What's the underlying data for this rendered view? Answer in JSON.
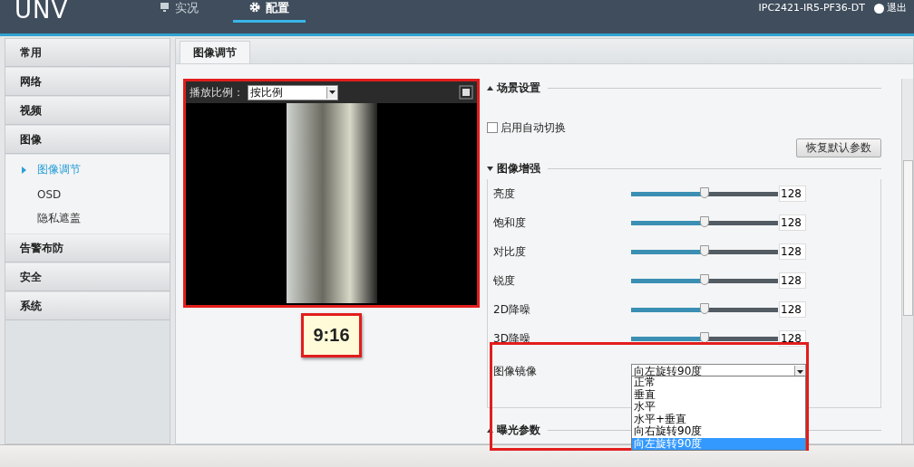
{
  "header": {
    "logo": "UNV",
    "nav": [
      {
        "label": "实况",
        "selected": false
      },
      {
        "label": "配置",
        "selected": true
      }
    ],
    "device": "IPC2421-IR5-PF36-DT",
    "logout": "退出"
  },
  "sidebar": {
    "items": [
      {
        "label": "常用"
      },
      {
        "label": "网络"
      },
      {
        "label": "视频"
      },
      {
        "label": "图像",
        "children": [
          {
            "label": "图像调节",
            "selected": true
          },
          {
            "label": "OSD",
            "selected": false
          },
          {
            "label": "隐私遮盖",
            "selected": false
          }
        ]
      },
      {
        "label": "告警布防"
      },
      {
        "label": "安全"
      },
      {
        "label": "系统"
      }
    ]
  },
  "tabs": [
    {
      "label": "图像调节",
      "selected": true
    }
  ],
  "video": {
    "ratio_label": "播放比例：",
    "ratio_value": "按比例",
    "aspect_badge": "9:16"
  },
  "scene": {
    "title": "场景设置",
    "auto_switch": {
      "label": "启用自动切换",
      "checked": false
    },
    "restore_button": "恢复默认参数"
  },
  "enhance": {
    "title": "图像增强",
    "sliders": [
      {
        "label": "亮度",
        "level": 0.5,
        "value": "128"
      },
      {
        "label": "饱和度",
        "level": 0.5,
        "value": "128"
      },
      {
        "label": "对比度",
        "level": 0.5,
        "value": "128"
      },
      {
        "label": "锐度",
        "level": 0.5,
        "value": "128"
      },
      {
        "label": "2D降噪",
        "level": 0.5,
        "value": "128"
      },
      {
        "label": "3D降噪",
        "level": 0.5,
        "value": "128"
      }
    ],
    "mirror": {
      "label": "图像镜像",
      "value": "向左旋转90度",
      "expanded": true,
      "options": [
        {
          "label": "正常",
          "selected": false
        },
        {
          "label": "垂直",
          "selected": false
        },
        {
          "label": "水平",
          "selected": false
        },
        {
          "label": "水平+垂直",
          "selected": false
        },
        {
          "label": "向右旋转90度",
          "selected": false
        },
        {
          "label": "向左旋转90度",
          "selected": true
        }
      ]
    }
  },
  "exposure": {
    "title": "曝光参数"
  }
}
